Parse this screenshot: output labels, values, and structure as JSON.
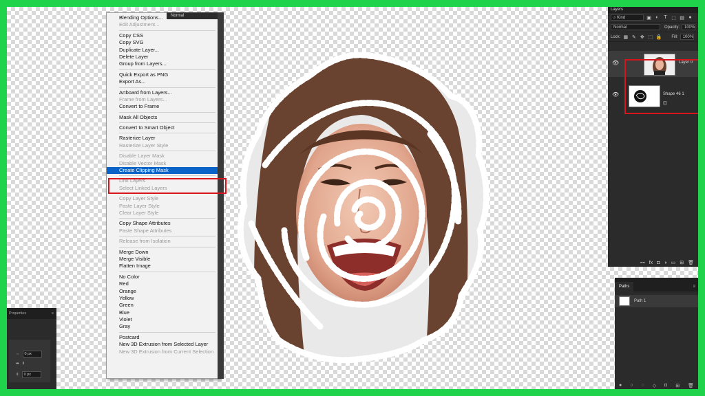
{
  "colors": {
    "border_green": "#1fd34a",
    "highlight_red": "#d8141d",
    "menu_selection": "#0a64c8"
  },
  "blend_mode_top": "Normal",
  "context_menu": {
    "groups": [
      [
        {
          "label": "Blending Options..."
        },
        {
          "label": "Edit Adjustment...",
          "disabled": true
        }
      ],
      [
        {
          "label": "Copy CSS"
        },
        {
          "label": "Copy SVG"
        },
        {
          "label": "Duplicate Layer..."
        },
        {
          "label": "Delete Layer"
        },
        {
          "label": "Group from Layers..."
        }
      ],
      [
        {
          "label": "Quick Export as PNG"
        },
        {
          "label": "Export As..."
        }
      ],
      [
        {
          "label": "Artboard from Layers..."
        },
        {
          "label": "Frame from Layers...",
          "disabled": true
        },
        {
          "label": "Convert to Frame"
        }
      ],
      [
        {
          "label": "Mask All Objects"
        }
      ],
      [
        {
          "label": "Convert to Smart Object"
        }
      ],
      [
        {
          "label": "Rasterize Layer"
        },
        {
          "label": "Rasterize Layer Style",
          "disabled": true
        }
      ],
      [
        {
          "label": "Disable Layer Mask",
          "disabled": true
        },
        {
          "label": "Disable Vector Mask",
          "disabled": true
        },
        {
          "label": "Create Clipping Mask",
          "selected": true
        }
      ],
      [
        {
          "label": "Link Layers",
          "disabled": true
        },
        {
          "label": "Select Linked Layers",
          "disabled": true
        }
      ],
      [
        {
          "label": "Copy Layer Style",
          "disabled": true
        },
        {
          "label": "Paste Layer Style",
          "disabled": true
        },
        {
          "label": "Clear Layer Style",
          "disabled": true
        }
      ],
      [
        {
          "label": "Copy Shape Attributes"
        },
        {
          "label": "Paste Shape Attributes",
          "disabled": true
        }
      ],
      [
        {
          "label": "Release from Isolation",
          "disabled": true
        }
      ],
      [
        {
          "label": "Merge Down"
        },
        {
          "label": "Merge Visible"
        },
        {
          "label": "Flatten Image"
        }
      ],
      [
        {
          "label": "No Color"
        },
        {
          "label": "Red"
        },
        {
          "label": "Orange"
        },
        {
          "label": "Yellow"
        },
        {
          "label": "Green"
        },
        {
          "label": "Blue"
        },
        {
          "label": "Violet"
        },
        {
          "label": "Gray"
        }
      ],
      [
        {
          "label": "Postcard"
        },
        {
          "label": "New 3D Extrusion from Selected Layer"
        },
        {
          "label": "New 3D Extrusion from Current Selection",
          "disabled": true
        }
      ]
    ]
  },
  "layers_panel": {
    "tab": "Layers",
    "filter_kind": "Kind",
    "blend_mode": "Normal",
    "opacity_label": "Opacity:",
    "opacity_value": "100%",
    "lock_label": "Lock:",
    "fill_label": "Fill:",
    "fill_value": "100%",
    "layers": [
      {
        "name": "Layer 0",
        "visible_icon": "eye-icon"
      },
      {
        "name": "Shape 46 1",
        "visible_icon": "eye-icon"
      }
    ],
    "footer_icons": [
      "link-icon",
      "fx-icon",
      "mask-icon",
      "adjustment-icon",
      "folder-icon",
      "new-layer-icon",
      "trash-icon"
    ]
  },
  "paths_panel": {
    "tab": "Paths",
    "paths": [
      {
        "name": "Path 1"
      }
    ]
  },
  "properties_panel": {
    "tab": "Properties",
    "x_value": "0 px",
    "y_value": "0 px"
  }
}
